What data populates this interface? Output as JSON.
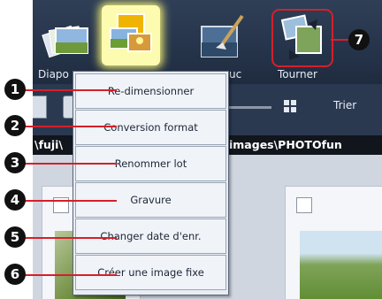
{
  "toolbar": {
    "labels": {
      "diaporama": "Diapo",
      "partial_mid": "uc",
      "tourner": "Tourner"
    }
  },
  "viewbar": {
    "trier": "Trier"
  },
  "pathbar": {
    "left_text": "\\fuji\\",
    "right_text": "images\\PHOTOfun"
  },
  "menu": {
    "items": [
      "Re-dimensionner",
      "Conversion format",
      "Renommer lot",
      "Gravure",
      "Changer date d'enr.",
      "Créer une image fixe"
    ]
  },
  "callouts": [
    "1",
    "2",
    "3",
    "4",
    "5",
    "6",
    "7"
  ],
  "colors": {
    "leader": "#d4202a",
    "callout_bg": "#111111",
    "toolbar_bg": "#243248",
    "menu_bg": "#e8ecf3"
  }
}
